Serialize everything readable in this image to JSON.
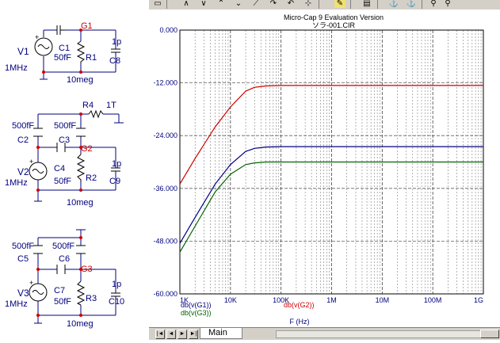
{
  "schematic": {
    "labels": {
      "g1": "G1",
      "c1": "C1",
      "c1_val": "50fF",
      "r1": "R1",
      "c8": "C8",
      "c8_val": "1p",
      "v1": "V1",
      "v1_freq": "1MHz",
      "r1_val": "10meg",
      "r4": "R4",
      "r4_val": "1T",
      "c2_val": "500fF",
      "c2": "C2",
      "c3_val": "500fF",
      "c3": "C3",
      "g2": "G2",
      "c4": "C4",
      "c4_val": "50fF",
      "r2": "R2",
      "c9": "C9",
      "c9_val": "1p",
      "v2": "V2",
      "v2_freq": "1MHz",
      "r2_val": "10meg",
      "c5_val": "500fF",
      "c5": "C5",
      "c6_val": "500fF",
      "c6": "C6",
      "g3": "G3",
      "c7": "C7",
      "c7_val": "50fF",
      "r3": "R3",
      "c10": "C10",
      "c10_val": "1p",
      "v3": "V3",
      "v3_freq": "1MHz",
      "r3_val": "10meg"
    },
    "colors": {
      "wire": "#00007f",
      "component": "#000000",
      "node": "#cc0000"
    }
  },
  "toolbar": {
    "icons": [
      "ruler-icon",
      "peak-icon",
      "valley-icon",
      "high-icon",
      "low-icon",
      "slope-icon",
      "next-icon",
      "prev-icon",
      "grid-icon",
      "label-icon",
      "tag-icon",
      "zoom-in-icon",
      "zoom-out-icon"
    ]
  },
  "plot": {
    "title": "Micro-Cap 9 Evaluation Version",
    "file": "ソラ-001.CIR",
    "xlabel": "F (Hz)",
    "legend": {
      "g1": "db(v(G1))",
      "g3": "db(v(G3))",
      "g2": "db(v(G2))"
    },
    "colors": {
      "g1": "#cc0000",
      "g2": "#000080",
      "g3": "#006400",
      "grid": "#000000",
      "text": "#00007f"
    }
  },
  "chart_data": {
    "type": "line",
    "x_scale": "log",
    "xlim": [
      1000,
      1000000000
    ],
    "ylim": [
      -60,
      0
    ],
    "xticks": [
      "1K",
      "10K",
      "100K",
      "1M",
      "10M",
      "100M",
      "1G"
    ],
    "yticks": [
      "0.000",
      "-12.000",
      "-24.000",
      "-36.000",
      "-48.000",
      "-60.000"
    ],
    "series": [
      {
        "name": "db(v(G1))",
        "x": [
          1000,
          2000,
          5000,
          10000,
          20000,
          30000,
          50000,
          100000,
          1000000,
          10000000,
          1000000000
        ],
        "y": [
          -35.0,
          -29.2,
          -22.0,
          -17.5,
          -13.9,
          -13.0,
          -12.7,
          -12.6,
          -12.6,
          -12.6,
          -12.6
        ]
      },
      {
        "name": "db(v(G2))",
        "x": [
          1000,
          2000,
          5000,
          10000,
          20000,
          30000,
          50000,
          100000,
          1000000,
          10000000,
          1000000000
        ],
        "y": [
          -48.5,
          -42.6,
          -35.0,
          -30.6,
          -27.6,
          -26.9,
          -26.6,
          -26.5,
          -26.5,
          -26.5,
          -26.5
        ]
      },
      {
        "name": "db(v(G3))",
        "x": [
          1000,
          2000,
          5000,
          10000,
          20000,
          30000,
          50000,
          100000,
          1000000,
          10000000,
          1000000000
        ],
        "y": [
          -50.5,
          -44.6,
          -36.8,
          -32.8,
          -30.6,
          -30.2,
          -30.0,
          -30.0,
          -30.0,
          -30.0,
          -30.0
        ]
      }
    ]
  },
  "tabs": {
    "nav_first": "|◄",
    "nav_prev": "◄",
    "nav_next": "►",
    "nav_last": "►|",
    "main_label": "Main"
  }
}
